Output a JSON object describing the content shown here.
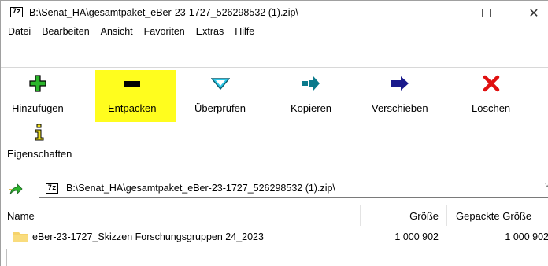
{
  "window": {
    "title": "B:\\Senat_HA\\gesamtpaket_eBer-23-1727_526298532 (1).zip\\",
    "app_icon_text": "7z"
  },
  "menu": [
    "Datei",
    "Bearbeiten",
    "Ansicht",
    "Favoriten",
    "Extras",
    "Hilfe"
  ],
  "toolbar": {
    "add": "Hinzufügen",
    "extract": "Entpacken",
    "test": "Überprüfen",
    "copy": "Kopieren",
    "move": "Verschieben",
    "delete": "Löschen",
    "info": "Eigenschaften"
  },
  "colors": {
    "highlight": "#fffd1e",
    "add_green": "#2bb52b",
    "test_cyan": "#29c6e6",
    "copy_teal": "#0b7a8c",
    "move_navy": "#1a1a8c",
    "delete_red": "#e01010",
    "folder_yellow": "#f6d36b"
  },
  "address": {
    "icon_text": "7z",
    "path": "B:\\Senat_HA\\gesamtpaket_eBer-23-1727_526298532 (1).zip\\"
  },
  "columns": {
    "name": "Name",
    "size": "Größe",
    "packed": "Gepackte Größe"
  },
  "files": [
    {
      "name": "eBer-23-1727_Skizzen Forschungsgruppen 24_2023",
      "size": "1 000 902",
      "packed": "1 000 902",
      "icon": "folder-icon"
    }
  ]
}
